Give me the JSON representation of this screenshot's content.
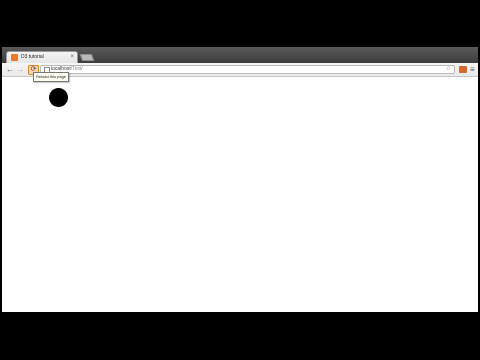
{
  "tab": {
    "title": "D3 tutorial",
    "close": "×"
  },
  "toolbar": {
    "back": "←",
    "forward": "→",
    "reload": "⟳",
    "reload_tooltip": "Reload this page",
    "star": "☆",
    "menu": "≡"
  },
  "address": {
    "host": "localhost",
    "path": "/Test/"
  },
  "icons": {
    "favicon": "page-favicon",
    "extension": "extension-icon"
  },
  "colors": {
    "circle": "#000000",
    "tab_favicon": "#e8792b"
  }
}
